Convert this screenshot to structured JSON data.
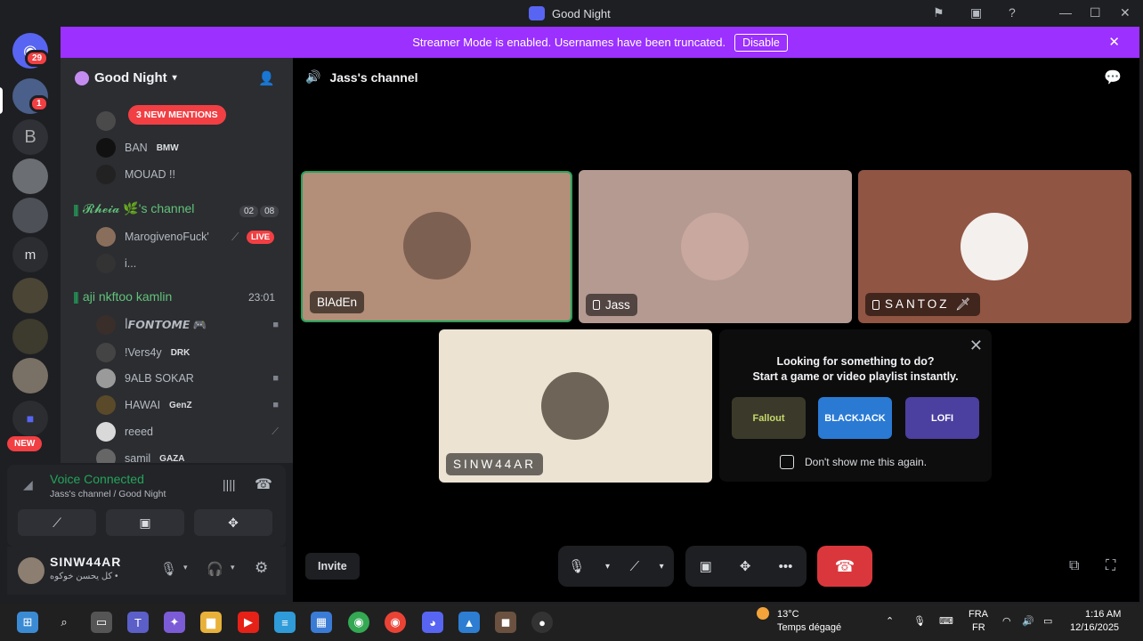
{
  "window": {
    "title": "Good Night",
    "controls": [
      "flag-icon",
      "inbox-icon",
      "help-icon",
      "minimize-icon",
      "maximize-icon",
      "close-icon"
    ]
  },
  "banner": {
    "message": "Streamer Mode is enabled. Usernames have been truncated.",
    "button": "Disable"
  },
  "rail": {
    "dm_badge": "29",
    "server_badge": "1",
    "letter_server": "m",
    "new_label": "NEW"
  },
  "sidebar": {
    "server_name": "Good Night",
    "mentions": "3 NEW MENTIONS",
    "members_top": [
      {
        "name": "",
        "tag": ""
      },
      {
        "name": "BAN",
        "tag": "BMW"
      },
      {
        "name": "MOUAD !!",
        "tag": ""
      }
    ],
    "channel1": {
      "name": "𝓡𝓱𝓮𝓲𝓪 🌿's channel",
      "count_a": "02",
      "count_b": "08",
      "members": [
        {
          "name": "MarogivenoFuck'",
          "badge": "LIVE"
        },
        {
          "name": "i..."
        }
      ]
    },
    "channel2": {
      "name": "aji nkftoo kamlin",
      "timer": "23:01",
      "members": [
        {
          "name": "ꟾ𝙁𝙊𝙉𝙏𝙊𝙈𝙀 🎮",
          "tag": ""
        },
        {
          "name": "!Vers4y",
          "tag": "DRK"
        },
        {
          "name": "9ALB SOKAR",
          "tag": ""
        },
        {
          "name": "HAWAI",
          "tag": "GenZ"
        },
        {
          "name": "reeed",
          "tag": ""
        },
        {
          "name": "samil",
          "tag": "GAZA"
        }
      ]
    }
  },
  "voice_panel": {
    "status": "Voice Connected",
    "location": "Jass's channel / Good Night"
  },
  "user_panel": {
    "username": "SINW44AR",
    "custom_status": "كل يحسن خوكوه •"
  },
  "stage": {
    "channel": "Jass's channel",
    "tiles": [
      {
        "name": "BlAdEn"
      },
      {
        "name": "Jass"
      },
      {
        "name": "SANTOZ 🗡"
      },
      {
        "name": "SINW44AR"
      }
    ],
    "activity": {
      "headline": "Looking for something to do?",
      "subline": "Start a game or video playlist instantly.",
      "cards": [
        "Fallout",
        "BLACKJACK",
        "LOFI"
      ],
      "checkbox": "Don't show me this again."
    },
    "invite": "Invite"
  },
  "taskbar": {
    "weather_temp": "13°C",
    "weather_desc": "Temps dégagé",
    "lang_top": "FRA",
    "lang_bottom": "FR",
    "time": "1:16 AM",
    "date": "12/16/2025"
  },
  "colors": {
    "accent": "#9b30ff",
    "online": "#23a55a",
    "danger": "#da373c"
  }
}
